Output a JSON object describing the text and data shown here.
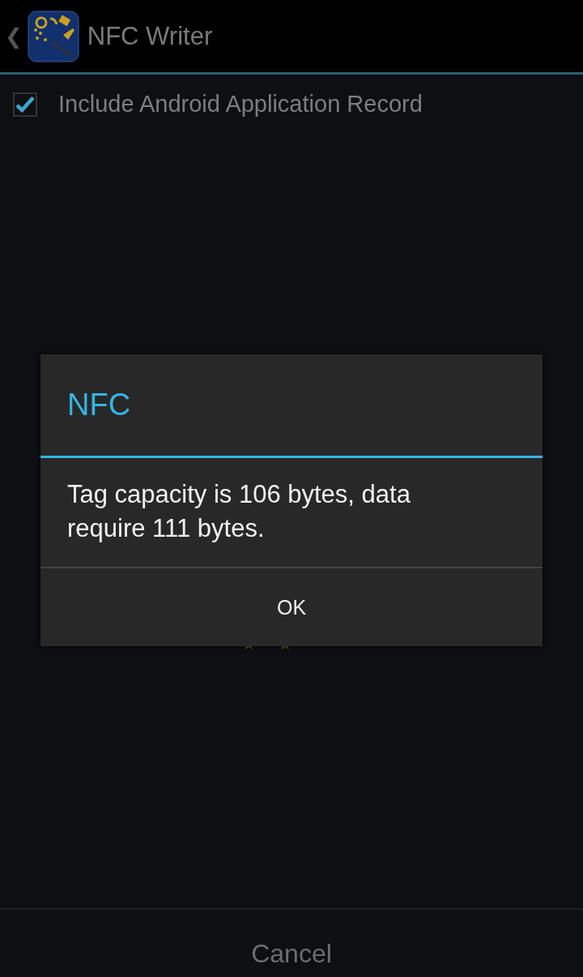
{
  "action_bar": {
    "back": "❮",
    "title": "NFC Writer"
  },
  "option": {
    "label": "Include Android Application Record",
    "checked": true
  },
  "dialog": {
    "title": "NFC",
    "message": "Tag capacity is 106 bytes, data require 111 bytes.",
    "button": "OK"
  },
  "footer": {
    "button": "Cancel"
  }
}
